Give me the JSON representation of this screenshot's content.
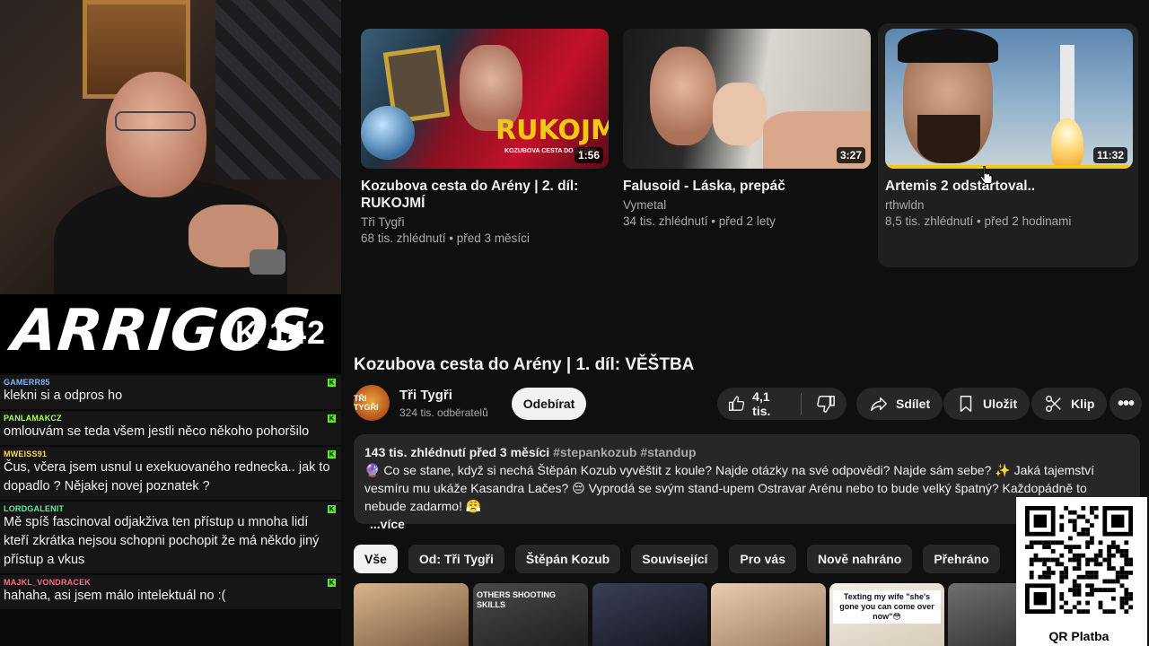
{
  "stream": {
    "brand_logo": "ARRIGOS",
    "brand_count": "K 142",
    "chat": [
      {
        "user": "GAMERR85",
        "user_color": "#7ab8ff",
        "text": "klekni si a odpros ho"
      },
      {
        "user": "PANLAMAKCZ",
        "user_color": "#a6ff4d",
        "text": "omlouvám se teda všem jestli něco někoho pohoršilo"
      },
      {
        "user": "MWEISS91",
        "user_color": "#ffd84d",
        "text": "Čus, včera jsem usnul u exekuovaného rednecka.. jak to dopadlo ? Nějakej novej poznatek ?"
      },
      {
        "user": "LORDGALENIT",
        "user_color": "#5cf0a0",
        "text": "Mě spíš fascinoval odjakživa ten přístup u mnoha lidí kteří zkrátka nejsou schopni pochopit že má někdo jiný přístup a vkus"
      },
      {
        "user": "MAJKL_VONDRACEK",
        "user_color": "#ff6b8b",
        "text": "hahaha, asi jsem málo intelektuál no :("
      }
    ],
    "kick_badge": "K"
  },
  "related_top": [
    {
      "title": "Kozubova cesta do Arény | 2. díl: RUKOJMÍ",
      "channel": "Tři Tygři",
      "meta": "68 tis. zhlédnutí • před 3 měsíci",
      "duration": "1:56",
      "thumb_text": "RUKOJMÍ",
      "thumb_caption": "KOZUBOVA CESTA DO ARÉNY"
    },
    {
      "title": "Falusoid - Láska, prepáč",
      "channel": "Vymetal",
      "meta": "34 tis. zhlédnutí • před 2 lety",
      "duration": "3:27"
    },
    {
      "title": "Artemis 2 odstartoval..",
      "channel": "rthwldn",
      "meta": "8,5 tis. zhlédnutí • před 2 hodinami",
      "duration": "11:32"
    }
  ],
  "video": {
    "title": "Kozubova cesta do Arény | 1. díl: VĚŠTBA",
    "channel": "Tři Tygři",
    "avatar_text": "TŘI TYGŘI",
    "subscribers": "324 tis. odběratelů",
    "subscribe_label": "Odebírat",
    "likes": "4,1 tis.",
    "share_label": "Sdílet",
    "save_label": "Uložit",
    "clip_label": "Klip",
    "description": {
      "stats": "143 tis. zhlédnutí  před 3 měsíci",
      "hashtags": "#stepankozub #standup",
      "text": "🔮 Co se stane, když si nechá Štěpán Kozub vyvěštit z koule? Najde otázky na své odpovědi? Najde sám sebe? ✨ Jaká tajemství vesmíru mu ukáže Kasandra Lačes? 😔 Vyprodá se svým stand-upem Ostravar Arénu nebo to bude velký špatný? Každopádně to nebude zadarmo! 😤",
      "more": "...více"
    }
  },
  "chips": [
    "Vše",
    "Od: Tři Tygři",
    "Štěpán Kozub",
    "Související",
    "Pro vás",
    "Nově nahráno",
    "Přehráno"
  ],
  "recommendations": [
    {
      "thumb_text": "",
      "color_a": "#d9b48a",
      "color_b": "#7a5a40"
    },
    {
      "thumb_text": "OTHERS SHOOTING SKILLS",
      "color_a": "#4a4a4a",
      "color_b": "#1f1f1f"
    },
    {
      "thumb_text": "",
      "color_a": "#3a3f57",
      "color_b": "#14161f"
    },
    {
      "thumb_text": "",
      "color_a": "#e7cdb0",
      "color_b": "#a07d62"
    },
    {
      "thumb_text": "Texting my wife \"she's gone you can come over now\"😳",
      "color_a": "#f4efe6",
      "color_b": "#d8ccba"
    },
    {
      "thumb_text": "",
      "color_a": "#6f6f6f",
      "color_b": "#2c2c2c"
    }
  ],
  "qr": {
    "label": "QR Platba"
  },
  "colors": {
    "bg": "#0f0f0f",
    "pill": "#272727",
    "kick_green": "#53fc18",
    "progress": "#f2c811"
  }
}
